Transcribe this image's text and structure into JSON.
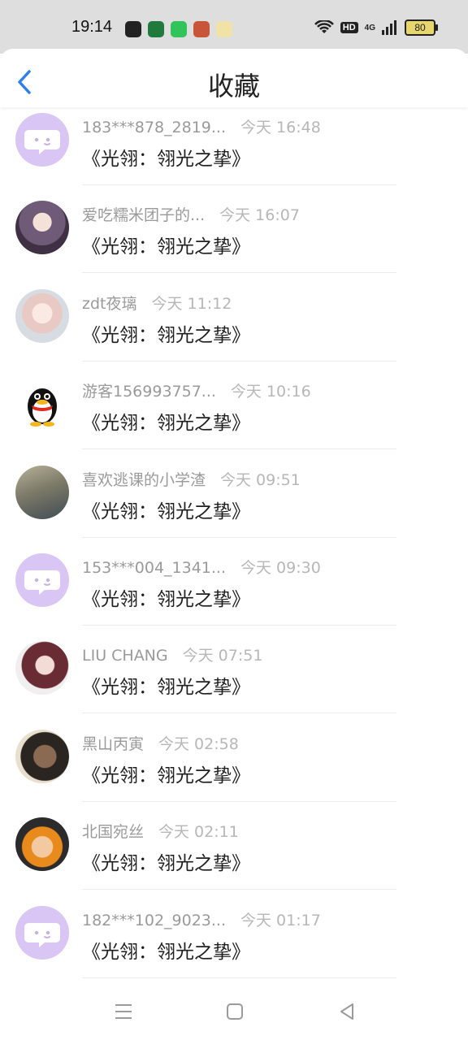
{
  "status_bar": {
    "time": "19:14",
    "network": "4G",
    "hd": "HD",
    "battery": "80"
  },
  "header": {
    "title": "收藏"
  },
  "items": [
    {
      "name": "183***878_2819...",
      "time": "今天 16:48",
      "message": "《光翎：翎光之挚》",
      "avatar": "chat-bubble-icon"
    },
    {
      "name": "爱吃糯米团子的...",
      "time": "今天 16:07",
      "message": "《光翎：翎光之挚》",
      "avatar": "anime-boy-avatar"
    },
    {
      "name": "zdt夜璃",
      "time": "今天 11:12",
      "message": "《光翎：翎光之挚》",
      "avatar": "anime-girl-avatar"
    },
    {
      "name": "游客156993757...",
      "time": "今天 10:16",
      "message": "《光翎：翎光之挚》",
      "avatar": "penguin-avatar"
    },
    {
      "name": "喜欢逃课的小学渣",
      "time": "今天 09:51",
      "message": "《光翎：翎光之挚》",
      "avatar": "illustration-avatar"
    },
    {
      "name": "153***004_1341...",
      "time": "今天 09:30",
      "message": "《光翎：翎光之挚》",
      "avatar": "chat-bubble-icon"
    },
    {
      "name": "LIU CHANG",
      "time": "今天 07:51",
      "message": "《光翎：翎光之挚》",
      "avatar": "portrait-avatar"
    },
    {
      "name": "黑山丙寅",
      "time": "今天 02:58",
      "message": "《光翎：翎光之挚》",
      "avatar": "photo-avatar"
    },
    {
      "name": "北国宛丝",
      "time": "今天 02:11",
      "message": "《光翎：翎光之挚》",
      "avatar": "ninja-avatar"
    },
    {
      "name": "182***102_9023...",
      "time": "今天 01:17",
      "message": "《光翎：翎光之挚》",
      "avatar": "chat-bubble-icon"
    }
  ],
  "colors": {
    "accent_blue": "#2f80ed",
    "chat_bubble_bg": "#d8c4f3"
  }
}
